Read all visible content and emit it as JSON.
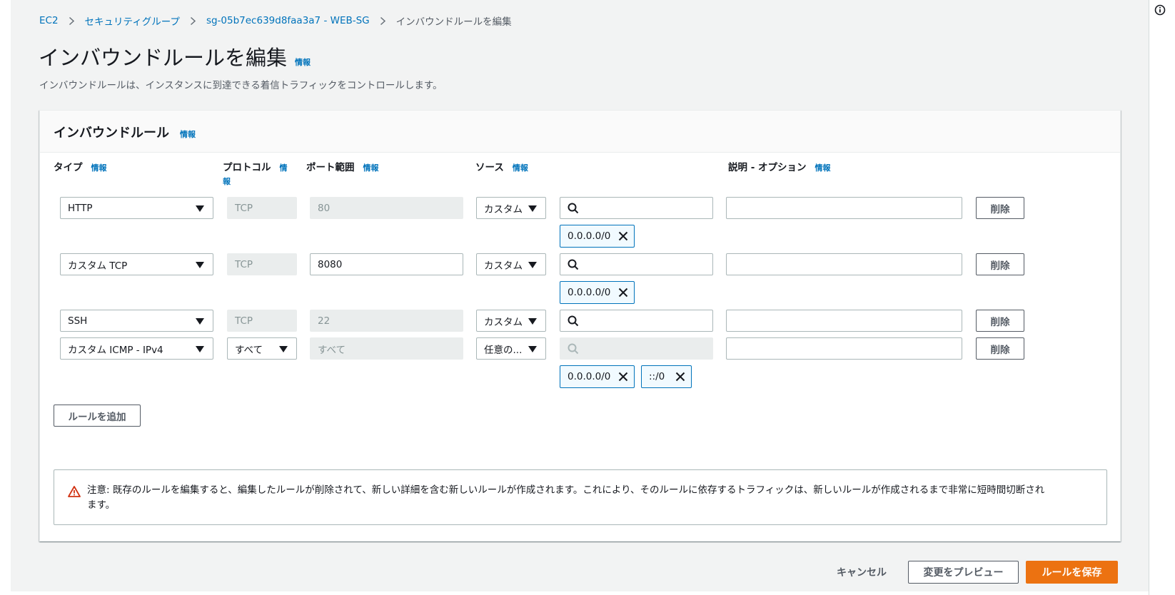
{
  "breadcrumb": {
    "items": [
      "EC2",
      "セキュリティグループ",
      "sg-05b7ec639d8faa3a7 - WEB-SG"
    ],
    "current": "インバウンドルールを編集"
  },
  "page": {
    "title": "インバウンドルールを編集",
    "info": "情報",
    "description": "インバウンドルールは、インスタンスに到達できる着信トラフィックをコントロールします。"
  },
  "panel": {
    "title": "インバウンドルール",
    "info": "情報",
    "columns": {
      "type": "タイプ",
      "protocol": "プロトコル",
      "port_range": "ポート範囲",
      "source": "ソース",
      "description": "説明 - オプション",
      "info": "情報",
      "protocol_info_1": "情",
      "protocol_info_2": "報"
    },
    "rules": [
      {
        "type": "HTTP",
        "protocol": "TCP",
        "port": "80",
        "source_type": "カスタム",
        "tokens": [
          "0.0.0.0/0"
        ],
        "description": "",
        "delete": "削除"
      },
      {
        "type": "カスタム TCP",
        "protocol": "TCP",
        "port": "8080",
        "source_type": "カスタム",
        "tokens": [
          "0.0.0.0/0"
        ],
        "description": "",
        "delete": "削除"
      },
      {
        "type": "SSH",
        "protocol": "TCP",
        "port": "22",
        "source_type": "カスタム",
        "tokens": [],
        "description": "",
        "delete": "削除"
      },
      {
        "type": "カスタム ICMP - IPv4",
        "protocol": "すべて",
        "port": "すべて",
        "source_type": "任意の...",
        "tokens": [
          "0.0.0.0/0",
          "::/0"
        ],
        "description": "",
        "delete": "削除"
      }
    ],
    "add_rule": "ルールを追加",
    "warning_line1": "注意: 既存のルールを編集すると、編集したルールが削除されて、新しい詳細を含む新しいルールが作成されます。これにより、そのルールに依存するトラフィックは、新しいルールが作成されるまで非常に短時間切断され",
    "warning_line2": "ます。"
  },
  "footer": {
    "cancel": "キャンセル",
    "preview": "変更をプレビュー",
    "save": "ルールを保存"
  },
  "colors": {
    "link": "#0073bb",
    "primary": "#ec7211",
    "warning": "#d13212",
    "token_border": "#0073bb",
    "token_bg": "#f1faff"
  },
  "icons": [
    "info-circle-icon",
    "chevron-right-icon",
    "caret-down-icon",
    "search-icon",
    "close-icon",
    "warning-triangle-icon"
  ]
}
